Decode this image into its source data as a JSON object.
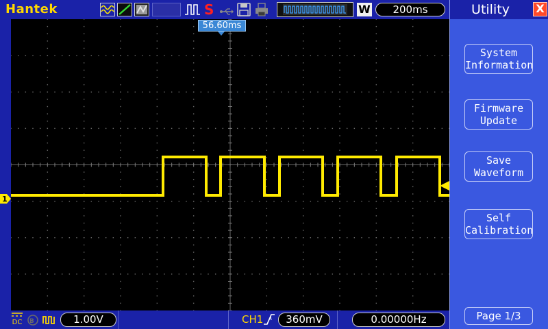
{
  "topbar": {
    "brand": "Hantek",
    "stop_indicator": "S",
    "wave_badge": "W",
    "timebase": "200ms"
  },
  "screen": {
    "trigger_time": "56.60ms",
    "ch1_marker": "1"
  },
  "bottombar": {
    "coupling": "DC",
    "ch1_volts": "1.00V",
    "trigger_source": "CH1",
    "trigger_level": "360mV",
    "frequency": "0.00000Hz"
  },
  "menu": {
    "title": "Utility",
    "close": "X",
    "items": [
      {
        "line1": "System",
        "line2": "Information"
      },
      {
        "line1": "Firmware",
        "line2": "Update"
      },
      {
        "line1": "Save",
        "line2": "Waveform"
      },
      {
        "line1": "Self",
        "line2": "Calibration"
      }
    ],
    "page": "Page 1/3"
  },
  "colors": {
    "trace": "#ffea00",
    "grid": "#5a5a5a",
    "screen_bg": "#000000",
    "panel_bg": "#1a22a8",
    "menu_bg": "#3a58e0",
    "close_red": "#ff4a2a",
    "time_badge": "#3b88d6"
  },
  "icons": [
    "wave-mode-icon",
    "slope-icon",
    "persistence-icon",
    "pulse-icon",
    "usb-icon",
    "save-icon",
    "print-icon",
    "bandwidth-limit-icon",
    "invert-icon",
    "rising-edge-icon"
  ]
}
